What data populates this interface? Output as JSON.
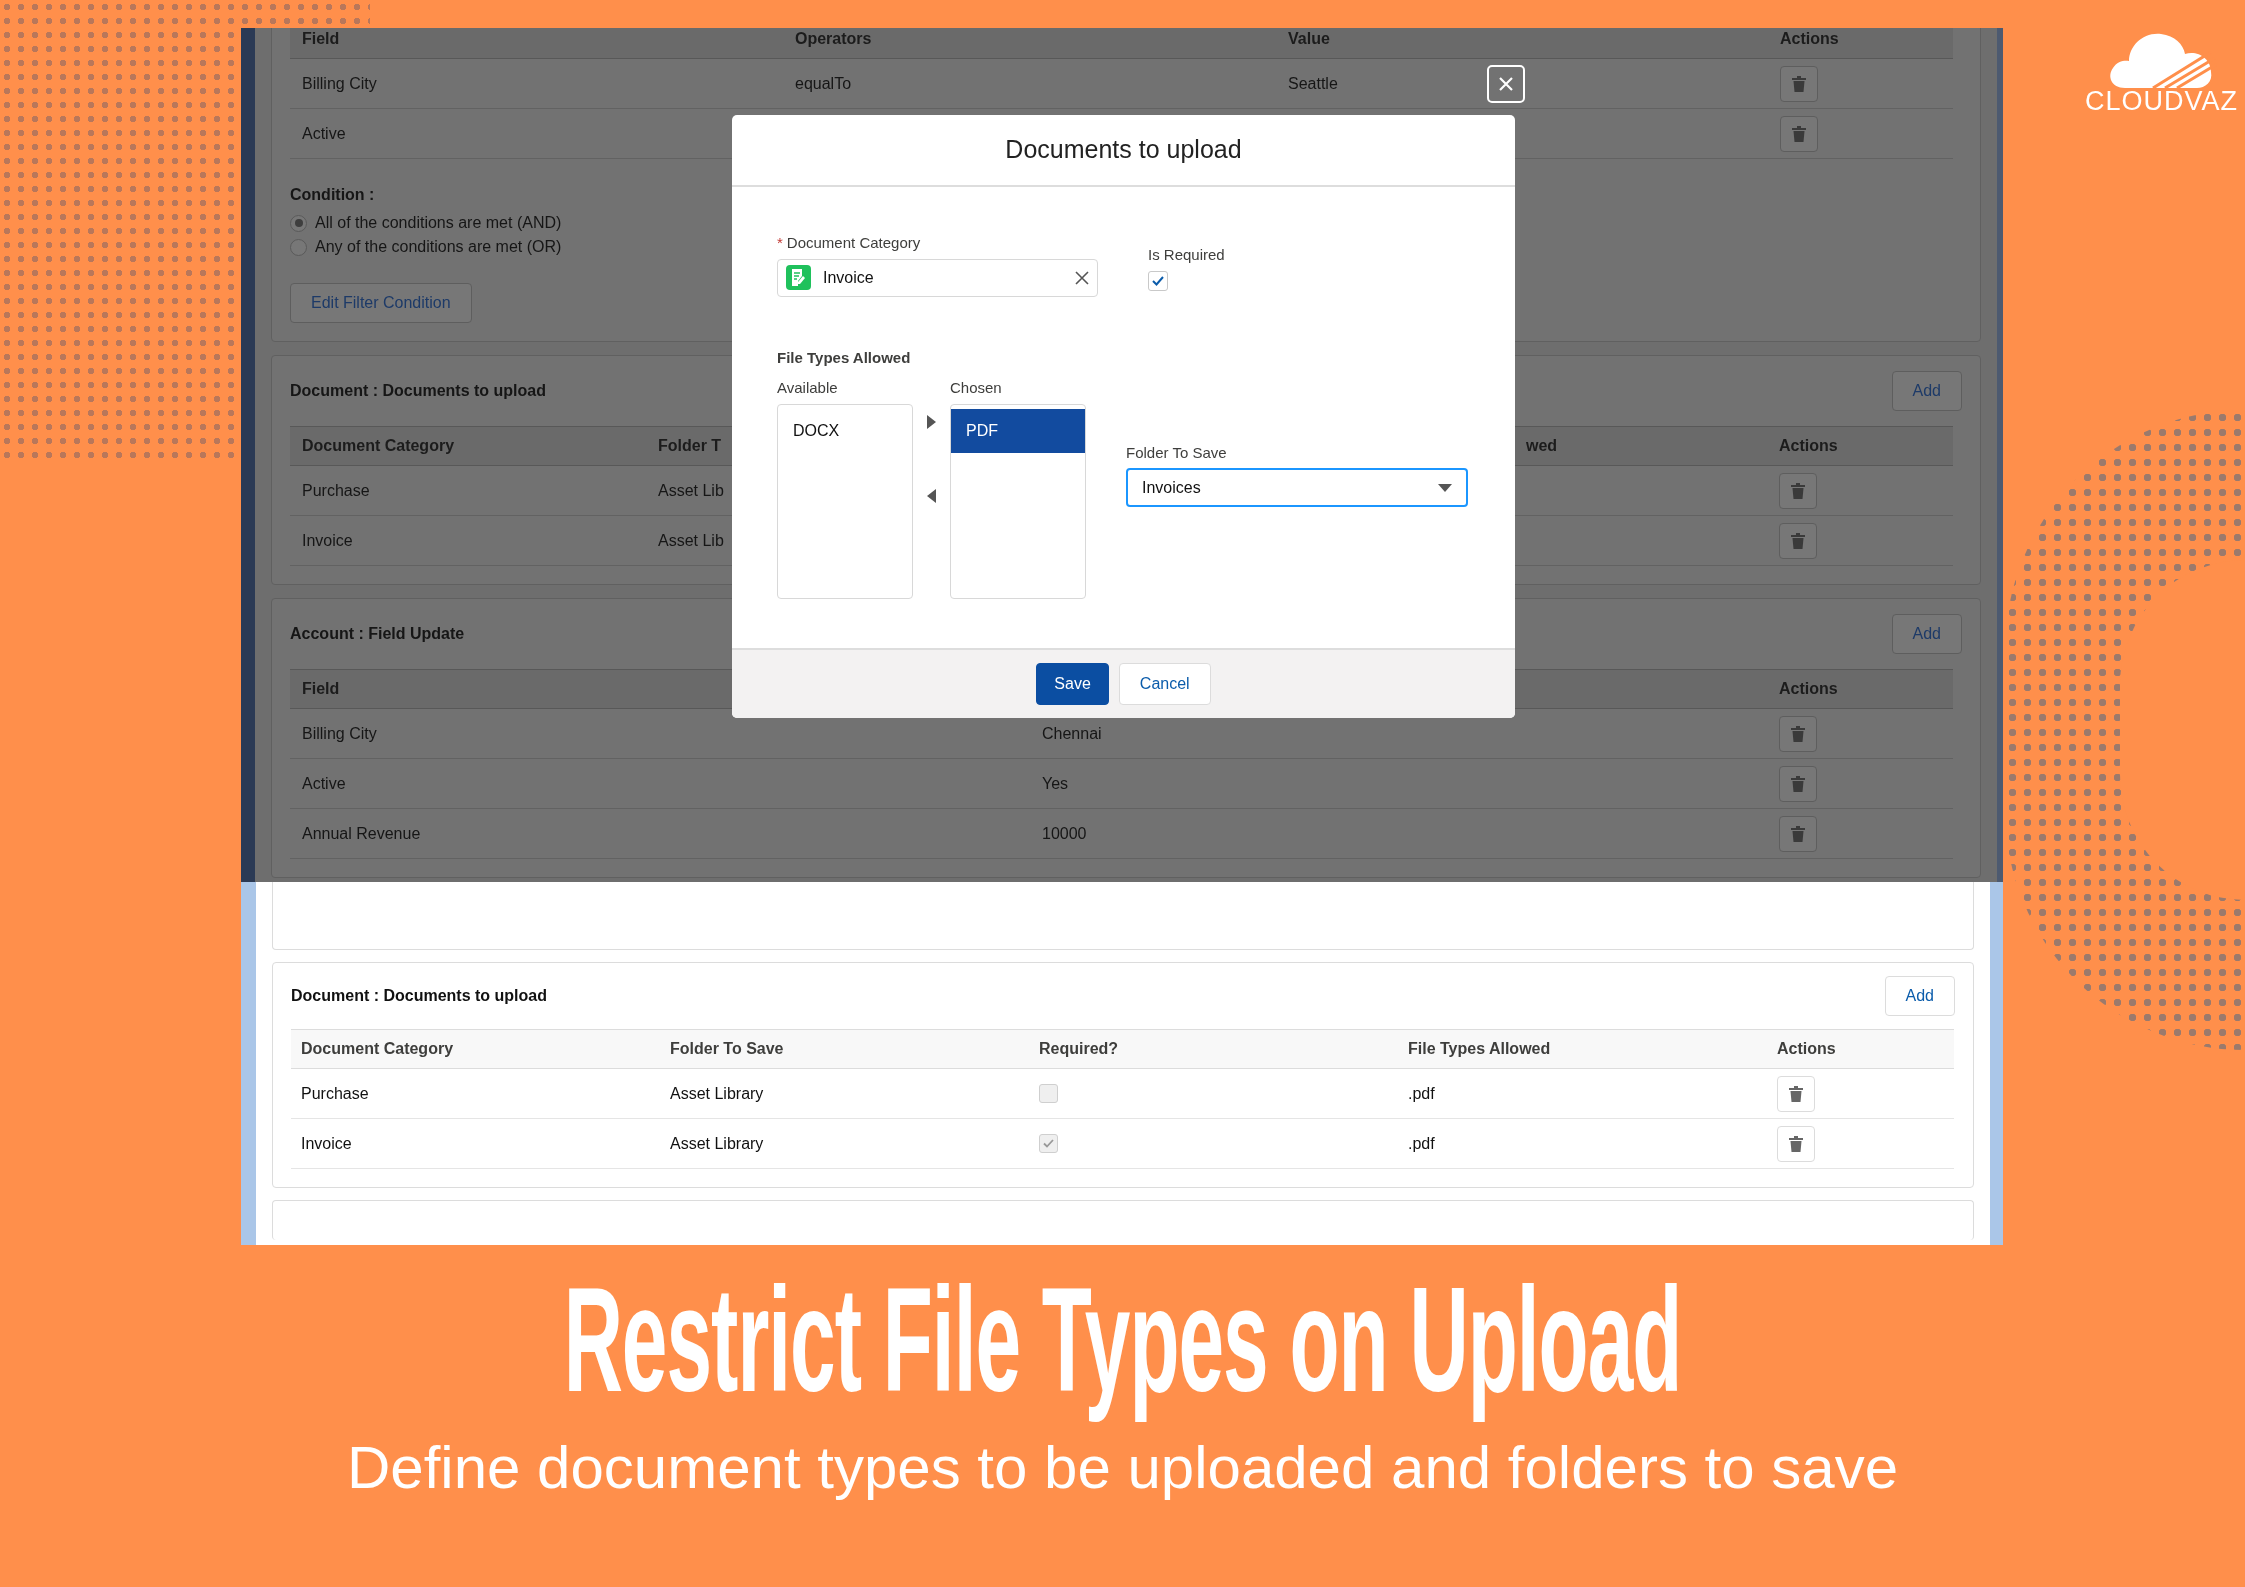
{
  "poster": {
    "headline": "Restrict File Types on Upload",
    "subtitle": "Define document types to be uploaded and folders to save",
    "logo_text": "CLOUDVAZ"
  },
  "filter_table": {
    "columns": [
      "Field",
      "Operators",
      "Value",
      "Actions"
    ],
    "rows": [
      {
        "cells": [
          "Billing City",
          "equalTo",
          "Seattle"
        ]
      },
      {
        "cells": [
          "Active"
        ]
      }
    ]
  },
  "condition": {
    "label": "Condition :",
    "options": [
      {
        "label": "All of the conditions are met (AND)",
        "selected": true
      },
      {
        "label": "Any of the conditions are met (OR)",
        "selected": false
      }
    ],
    "button": "Edit Filter Condition"
  },
  "documents_card": {
    "title": "Document : Documents to upload",
    "add_button": "Add",
    "columns": [
      "Document Category",
      "Folder T",
      "wed",
      "Actions"
    ],
    "rows": [
      {
        "cells": [
          "Purchase",
          "Asset Lib"
        ]
      },
      {
        "cells": [
          "Invoice",
          "Asset Lib"
        ]
      }
    ]
  },
  "field_update_card": {
    "title": "Account : Field Update",
    "add_button": "Add",
    "columns": [
      "Field",
      "Actions"
    ],
    "rows": [
      {
        "cells": [
          "Billing City",
          "Chennai"
        ]
      },
      {
        "cells": [
          "Active",
          "Yes"
        ]
      },
      {
        "cells": [
          "Annual Revenue",
          "10000"
        ]
      }
    ]
  },
  "modal": {
    "title": "Documents to upload",
    "document_category": {
      "required_mark": "*",
      "label": "Document Category",
      "value": "Invoice"
    },
    "is_required": {
      "label": "Is Required",
      "checked": true
    },
    "file_types": {
      "label": "File Types Allowed",
      "available": {
        "label": "Available",
        "items": [
          {
            "label": "DOCX",
            "selected": false
          }
        ]
      },
      "chosen": {
        "label": "Chosen",
        "items": [
          {
            "label": "PDF",
            "selected": true
          }
        ]
      }
    },
    "folder": {
      "label": "Folder To Save",
      "value": "Invoices"
    },
    "buttons": [
      {
        "label": "Save",
        "kind": "primary"
      },
      {
        "label": "Cancel",
        "kind": "neutral"
      }
    ]
  },
  "result_card": {
    "title": "Document : Documents to upload",
    "add_button": "Add",
    "columns": [
      "Document Category",
      "Folder To Save",
      "Required?",
      "File Types Allowed",
      "Actions"
    ],
    "rows": [
      {
        "category": "Purchase",
        "folder": "Asset Library",
        "required": false,
        "file_types": ".pdf"
      },
      {
        "category": "Invoice",
        "folder": "Asset Library",
        "required": true,
        "file_types": ".pdf"
      }
    ]
  }
}
